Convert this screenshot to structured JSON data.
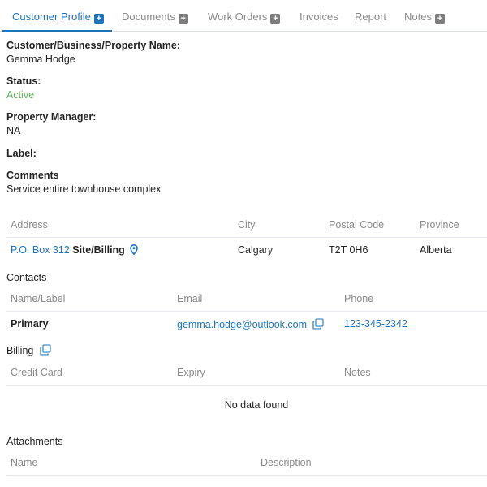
{
  "tabs": [
    {
      "label": "Customer Profile",
      "has_plus": true,
      "active": true
    },
    {
      "label": "Documents",
      "has_plus": true
    },
    {
      "label": "Work Orders",
      "has_plus": true
    },
    {
      "label": "Invoices"
    },
    {
      "label": "Report"
    },
    {
      "label": "Notes",
      "has_plus": true
    }
  ],
  "profile": {
    "name_label": "Customer/Business/Property Name:",
    "name_value": "Gemma Hodge",
    "status_label": "Status:",
    "status_value": "Active",
    "manager_label": "Property Manager:",
    "manager_value": "NA",
    "label_label": "Label:",
    "comments_label": "Comments",
    "comments_value": "Service entire townhouse complex"
  },
  "address_table": {
    "headers": {
      "address": "Address",
      "city": "City",
      "postal": "Postal Code",
      "province": "Province"
    },
    "row": {
      "address": "P.O. Box 312",
      "type": "Site/Billing",
      "city": "Calgary",
      "postal": "T2T 0H6",
      "province": "Alberta"
    }
  },
  "contacts": {
    "title": "Contacts",
    "headers": {
      "name": "Name/Label",
      "email": "Email",
      "phone": "Phone"
    },
    "row": {
      "name": "Primary",
      "email": "gemma.hodge@outlook.com",
      "phone": "123-345-2342"
    }
  },
  "billing": {
    "title": "Billing",
    "headers": {
      "card": "Credit Card",
      "expiry": "Expiry",
      "notes": "Notes"
    },
    "empty": "No data found"
  },
  "attachments": {
    "title": "Attachments",
    "headers": {
      "name": "Name",
      "description": "Description"
    }
  },
  "colors": {
    "accent": "#1e73be",
    "active": "#5cb85c",
    "muted": "#8a8a8a"
  }
}
